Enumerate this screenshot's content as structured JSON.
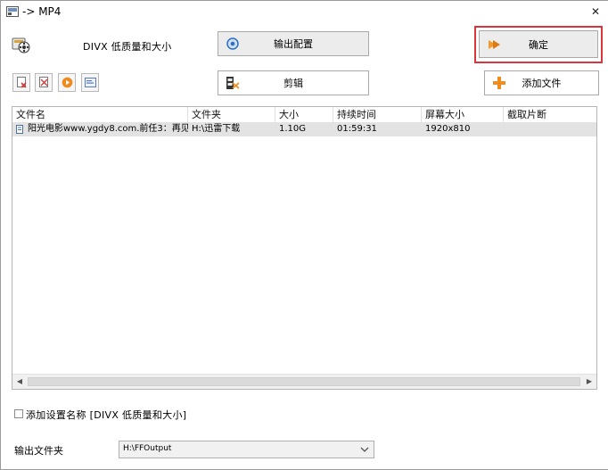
{
  "window": {
    "title": "-> MP4"
  },
  "preset": {
    "label": "DIVX 低质量和大小"
  },
  "buttons": {
    "output_config": "输出配置",
    "ok": "确定",
    "clip": "剪辑",
    "add_file": "添加文件"
  },
  "icons": {
    "app": "ffmpeg-format-factory-icon",
    "close": "close-icon",
    "output_config": "gear-icon",
    "ok": "arrow-right-icon",
    "clip": "film-scissors-icon",
    "add_file": "plus-icon",
    "toolbar": [
      "remove-file-icon",
      "clear-list-icon",
      "play-icon",
      "media-info-icon"
    ],
    "file": "video-file-icon"
  },
  "colors": {
    "highlight": "#d9363e",
    "ok_arrow": "#f29a2e",
    "plus": "#f28c1f",
    "row_selected": "#e3e3e3"
  },
  "table": {
    "columns": [
      "文件名",
      "文件夹",
      "大小",
      "持续时间",
      "屏幕大小",
      "截取片断"
    ],
    "rows": [
      {
        "name": "阳光电影www.ygdy8.com.前任3：再见...",
        "folder": "H:\\迅雷下载",
        "size": "1.10G",
        "duration": "01:59:31",
        "screen": "1920x810",
        "clip": ""
      }
    ]
  },
  "options": {
    "add_setting_name_label": "添加设置名称 [DIVX 低质量和大小]",
    "add_setting_name_checked": false
  },
  "output": {
    "label": "输出文件夹",
    "folder": "H:\\FFOutput"
  }
}
